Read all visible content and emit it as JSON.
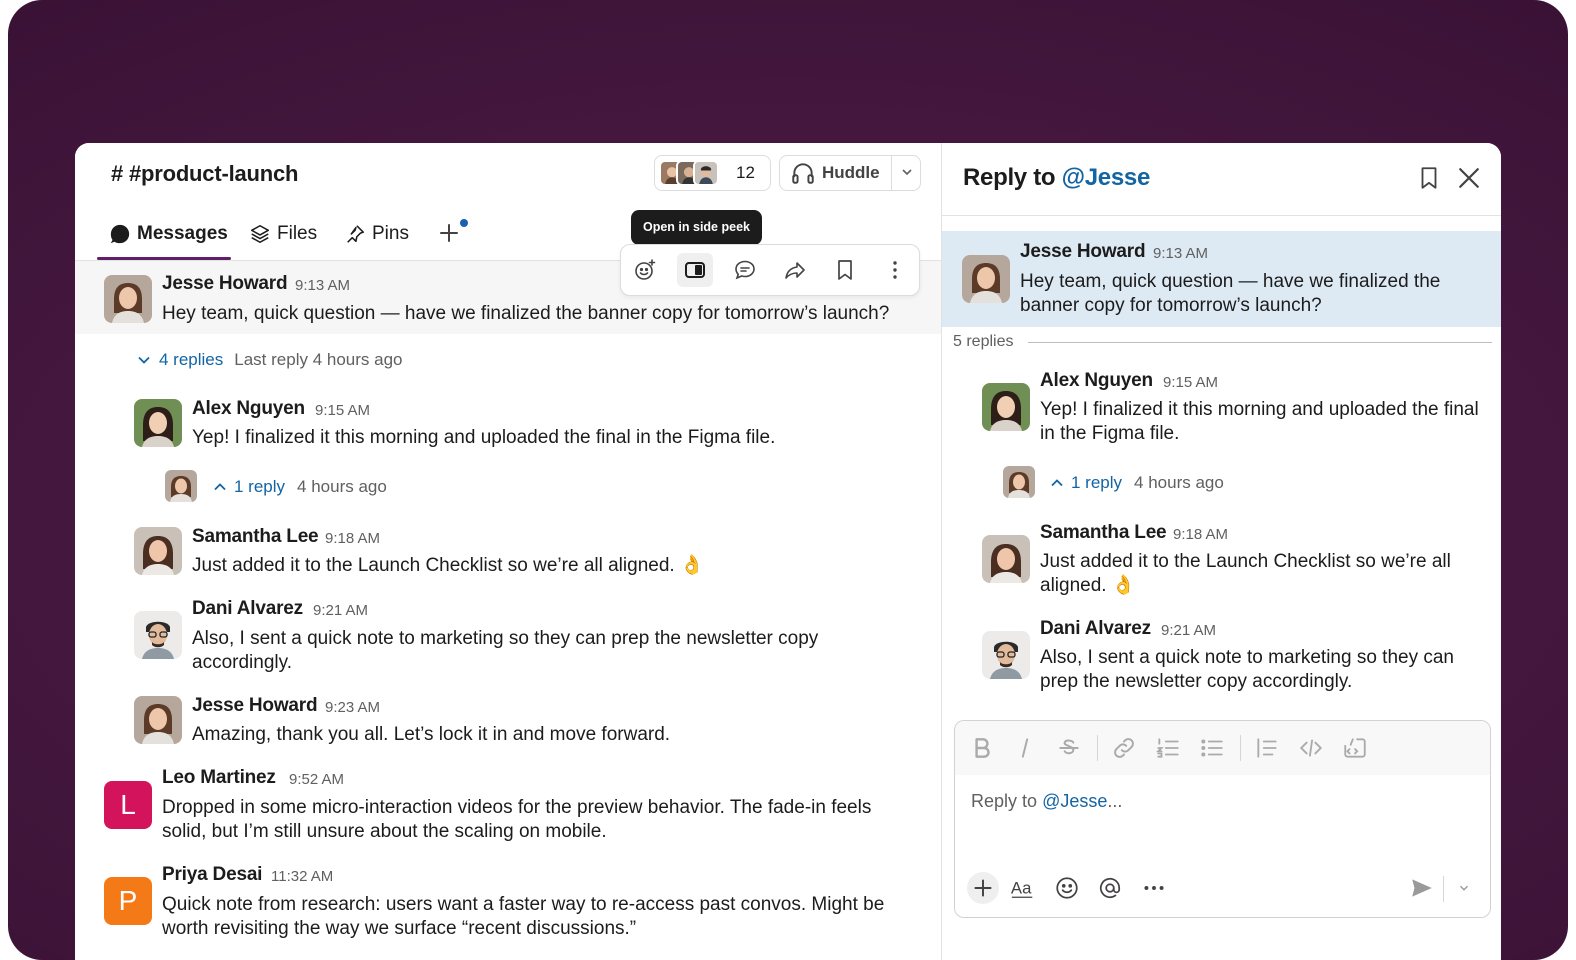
{
  "channel": {
    "title": "# #product-launch",
    "member_count": "12",
    "huddle_label": "Huddle"
  },
  "tabs": [
    {
      "label": "Messages"
    },
    {
      "label": "Files"
    },
    {
      "label": "Pins"
    }
  ],
  "tooltip": "Open in side peek",
  "messages": {
    "m1": {
      "name": "Jesse Howard",
      "time": "9:13 AM",
      "text": "Hey team, quick question — have we finalized the banner copy for tomorrow’s launch?"
    },
    "thread_summary": {
      "replies": "4 replies",
      "last": "Last reply 4 hours ago"
    },
    "m2": {
      "name": "Alex Nguyen",
      "time": "9:15 AM",
      "text": "Yep! I finalized it this morning and uploaded the final in the Figma file."
    },
    "sub": {
      "replies": "1 reply",
      "ago": "4 hours ago"
    },
    "m3": {
      "name": "Samantha Lee",
      "time": "9:18 AM",
      "text": "Just added it to the Launch Checklist so we’re all aligned. 👌"
    },
    "m4": {
      "name": "Dani Alvarez",
      "time": "9:21 AM",
      "text": "Also, I sent a quick note to marketing so they can prep the newsletter copy accordingly."
    },
    "m5": {
      "name": "Jesse Howard",
      "time": "9:23 AM",
      "text": "Amazing, thank you all. Let’s lock it in and move forward."
    },
    "m6": {
      "name": "Leo Martinez",
      "time": "9:52 AM",
      "initial": "L",
      "text": "Dropped in some micro-interaction videos for the preview behavior. The fade-in feels solid, but I’m still unsure about the scaling on mobile."
    },
    "m7": {
      "name": "Priya Desai",
      "time": "11:32 AM",
      "initial": "P",
      "text": "Quick note from research: users want a faster way to re-access past convos. Might be worth revisiting the way we surface “recent discussions.”"
    }
  },
  "reply_panel": {
    "title_prefix": "Reply to",
    "title_mention": "@Jesse",
    "divider": "5 replies",
    "r1": {
      "name": "Jesse Howard",
      "time": "9:13 AM",
      "text": "Hey team, quick question — have we finalized the banner copy for tomorrow’s launch?"
    },
    "r2": {
      "name": "Alex Nguyen",
      "time": "9:15 AM",
      "text": "Yep! I finalized it this morning and uploaded the final in the Figma file."
    },
    "sub": {
      "replies": "1 reply",
      "ago": "4 hours ago"
    },
    "r3": {
      "name": "Samantha Lee",
      "time": "9:18 AM",
      "text": "Just added it to the Launch Checklist so we’re all aligned. 👌"
    },
    "r4": {
      "name": "Dani Alvarez",
      "time": "9:21 AM",
      "text": "Also, I sent a quick note to marketing so they can prep the newsletter copy accordingly."
    },
    "composer": {
      "placeholder_prefix": "Reply to",
      "placeholder_mention": "@Jesse",
      "placeholder_suffix": "..."
    }
  },
  "colors": {
    "accent": "#611f69",
    "link": "#1264a3",
    "leo_avatar": "#d3135b",
    "priya_avatar": "#f47a17",
    "highlight": "#ddeaf4"
  }
}
